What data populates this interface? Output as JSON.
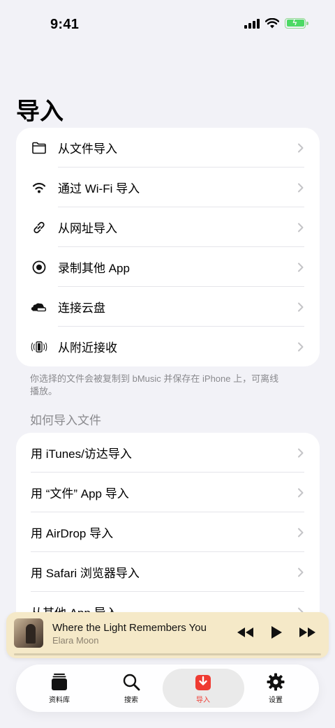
{
  "status": {
    "time": "9:41"
  },
  "page": {
    "title": "导入"
  },
  "import_options": [
    {
      "label": "从文件导入",
      "icon": "folder-icon"
    },
    {
      "label": "通过 Wi-Fi 导入",
      "icon": "wifi-icon"
    },
    {
      "label": "从网址导入",
      "icon": "link-icon"
    },
    {
      "label": "录制其他 App",
      "icon": "record-icon"
    },
    {
      "label": "连接云盘",
      "icon": "cloud-drive-icon"
    },
    {
      "label": "从附近接收",
      "icon": "nearby-phone-icon"
    }
  ],
  "footnote": "你选择的文件会被复制到 bMusic 并保存在 iPhone 上，可离线播放。",
  "how_to": {
    "header": "如何导入文件",
    "items": [
      {
        "label": "用 iTunes/访达导入"
      },
      {
        "label": "用 “文件” App 导入"
      },
      {
        "label": "用 AirDrop 导入"
      },
      {
        "label": "用 Safari 浏览器导入"
      },
      {
        "label": "从其他 App 导入"
      }
    ]
  },
  "now_playing": {
    "title": "Where the Light Remembers You",
    "artist": "Elara Moon",
    "progress": 0.0
  },
  "tabs": [
    {
      "label": "资料库",
      "icon": "library-icon",
      "active": false
    },
    {
      "label": "搜索",
      "icon": "search-icon",
      "active": false
    },
    {
      "label": "导入",
      "icon": "import-icon",
      "active": true
    },
    {
      "label": "设置",
      "icon": "gear-icon",
      "active": false
    }
  ],
  "colors": {
    "accent": "#ef3b32",
    "background": "#f2f2f7",
    "player_bg": "#f5e9c8"
  }
}
